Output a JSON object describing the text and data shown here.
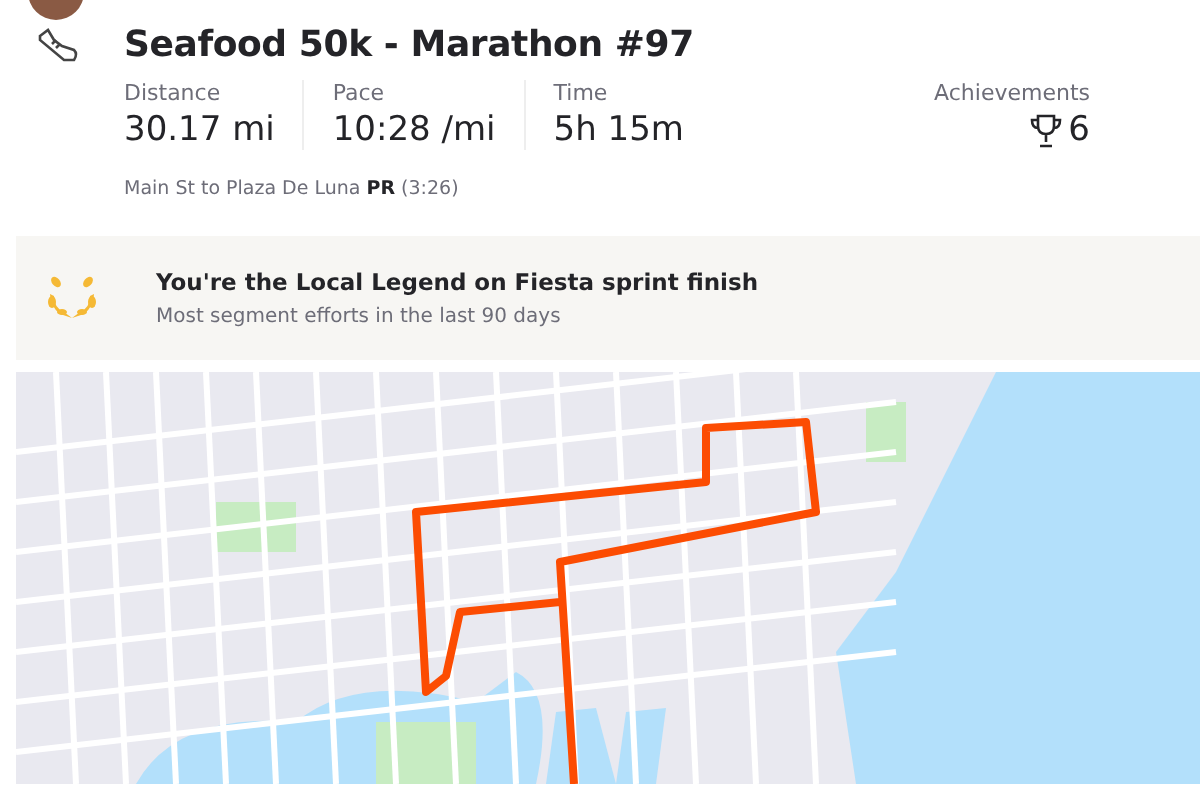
{
  "activity": {
    "title": "Seafood 50k - Marathon #97"
  },
  "stats": [
    {
      "label": "Distance",
      "value": "30.17 mi"
    },
    {
      "label": "Pace",
      "value": "10:28 /mi"
    },
    {
      "label": "Time",
      "value": "5h 15m"
    }
  ],
  "achievements": {
    "label": "Achievements",
    "count": "6"
  },
  "segment": {
    "text": "Main St to Plaza De Luna **PR** (3:26)"
  },
  "legend_banner": {
    "title": "You're the Local Legend on Fiesta sprint finish",
    "subtitle": "Most segment efforts in the last 90 days"
  }
}
